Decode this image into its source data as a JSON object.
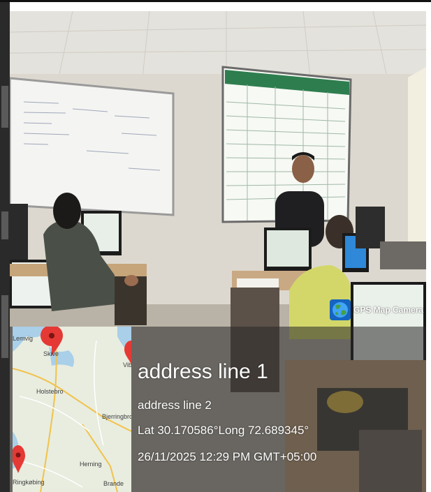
{
  "badge": {
    "label": "GPS Map Camera",
    "icon": "globe-icon"
  },
  "location": {
    "address_line_1": "address line 1",
    "address_line_2": "address line 2",
    "coordinates": "Lat 30.170586°Long 72.689345°",
    "timestamp": "26/11/2025 12:29 PM GMT+05:00"
  },
  "map": {
    "places": [
      "Skive",
      "Holstebro",
      "Herning",
      "Bjerringbro",
      "Brande",
      "Lemvig",
      "Ringkøbing",
      "Viborg"
    ],
    "pin_color": "#e53935"
  },
  "colors": {
    "overlay_text": "#ffffff",
    "overlay_panel": "rgba(40,40,40,0.55)"
  }
}
